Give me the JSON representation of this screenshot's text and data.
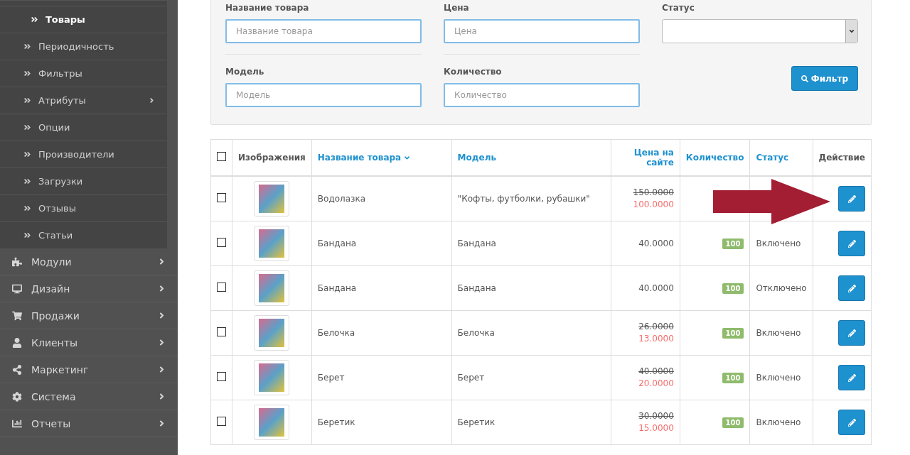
{
  "sidebar": {
    "submenu": [
      {
        "label": "Товары",
        "selected": true,
        "expandable": false
      },
      {
        "label": "Периодичность",
        "selected": false,
        "expandable": false
      },
      {
        "label": "Фильтры",
        "selected": false,
        "expandable": false
      },
      {
        "label": "Атрибуты",
        "selected": false,
        "expandable": true
      },
      {
        "label": "Опции",
        "selected": false,
        "expandable": false
      },
      {
        "label": "Производители",
        "selected": false,
        "expandable": false
      },
      {
        "label": "Загрузки",
        "selected": false,
        "expandable": false
      },
      {
        "label": "Отзывы",
        "selected": false,
        "expandable": false
      },
      {
        "label": "Статьи",
        "selected": false,
        "expandable": false
      }
    ],
    "items": [
      {
        "label": "Модули"
      },
      {
        "label": "Дизайн"
      },
      {
        "label": "Продажи"
      },
      {
        "label": "Клиенты"
      },
      {
        "label": "Маркетинг"
      },
      {
        "label": "Система"
      },
      {
        "label": "Отчеты"
      }
    ]
  },
  "filter": {
    "fields": [
      {
        "kind": "text",
        "label": "Название товара",
        "placeholder": "Название товара"
      },
      {
        "kind": "text",
        "label": "Цена",
        "placeholder": "Цена"
      },
      {
        "kind": "select",
        "label": "Статус"
      },
      {
        "kind": "text",
        "label": "Модель",
        "placeholder": "Модель"
      },
      {
        "kind": "text",
        "label": "Количество",
        "placeholder": "Количество"
      }
    ],
    "button": "Фильтр"
  },
  "table": {
    "header_checked": false,
    "columns": [
      {
        "kind": "checkbox"
      },
      {
        "kind": "plain",
        "label": "Изображения"
      },
      {
        "kind": "link",
        "label": "Название товара",
        "sorted": true
      },
      {
        "kind": "link",
        "label": "Модель",
        "sorted": false
      },
      {
        "kind": "link",
        "label": "Цена на сайте",
        "sorted": false
      },
      {
        "kind": "link",
        "label": "Количество",
        "sorted": false
      },
      {
        "kind": "link",
        "label": "Статус",
        "sorted": false
      },
      {
        "kind": "plain",
        "label": "Действие"
      }
    ],
    "rows": [
      {
        "checked": false,
        "name": "Водолазка",
        "model": "\"Кофты, футболки, рубашки\"",
        "price": "150.0000",
        "special": "100.0000"
      },
      {
        "checked": false,
        "name": "Бандана",
        "model": "Бандана",
        "price": "40.0000",
        "quantity": "100",
        "status": "Включено"
      },
      {
        "checked": false,
        "name": "Бандана",
        "model": "Бандана",
        "price": "40.0000",
        "quantity": "100",
        "status": "Отключено"
      },
      {
        "checked": false,
        "name": "Белочка",
        "model": "Белочка",
        "price": "26.0000",
        "special": "13.0000",
        "quantity": "100",
        "status": "Включено"
      },
      {
        "checked": false,
        "name": "Берет",
        "model": "Берет",
        "price": "40.0000",
        "special": "20.0000",
        "quantity": "100",
        "status": "Включено"
      },
      {
        "checked": false,
        "name": "Беретик",
        "model": "Беретик",
        "price": "30.0000",
        "special": "15.0000",
        "quantity": "100",
        "status": "Включено"
      }
    ]
  }
}
